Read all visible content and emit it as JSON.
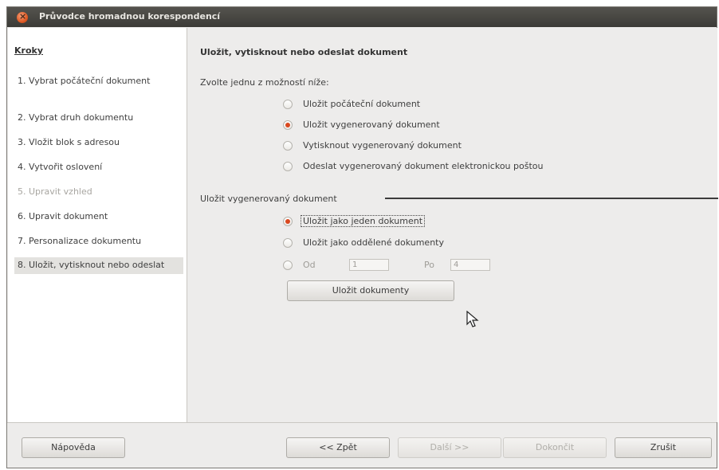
{
  "window": {
    "title": "Průvodce hromadnou korespondencí"
  },
  "sidebar": {
    "title": "Kroky",
    "steps": [
      {
        "label": "1. Vybrat počáteční dokument",
        "state": "normal"
      },
      {
        "label": "2. Vybrat druh dokumentu",
        "state": "normal"
      },
      {
        "label": "3. Vložit blok s adresou",
        "state": "normal"
      },
      {
        "label": "4. Vytvořit oslovení",
        "state": "normal"
      },
      {
        "label": "5. Upravit vzhled",
        "state": "disabled"
      },
      {
        "label": "6. Upravit dokument",
        "state": "normal"
      },
      {
        "label": "7. Personalizace dokumentu",
        "state": "normal"
      },
      {
        "label": "8. Uložit, vytisknout nebo odeslat",
        "state": "active"
      }
    ]
  },
  "content": {
    "heading": "Uložit, vytisknout nebo odeslat dokument",
    "prompt": "Zvolte jednu z možností níže:",
    "options": [
      {
        "label": "Uložit počáteční dokument",
        "checked": false
      },
      {
        "label": "Uložit vygenerovaný dokument",
        "checked": true
      },
      {
        "label": "Vytisknout vygenerovaný dokument",
        "checked": false
      },
      {
        "label": "Odeslat vygenerovaný dokument elektronickou poštou",
        "checked": false
      }
    ],
    "section_label": "Uložit vygenerovaný dokument",
    "save_options": [
      {
        "label": "Uložit jako jeden dokument",
        "checked": true
      },
      {
        "label": "Uložit jako oddělené dokumenty",
        "checked": false
      }
    ],
    "range": {
      "from_label": "Od",
      "from_value": "1",
      "to_label": "Po",
      "to_value": "4"
    },
    "save_button": "Uložit dokumenty"
  },
  "footer": {
    "help": "Nápověda",
    "back": "<< Zpět",
    "next": "Další >>",
    "finish": "Dokončit",
    "cancel": "Zrušit"
  },
  "colors": {
    "radio_checked": "#d9481f",
    "titlebar": "#3c3b37"
  }
}
